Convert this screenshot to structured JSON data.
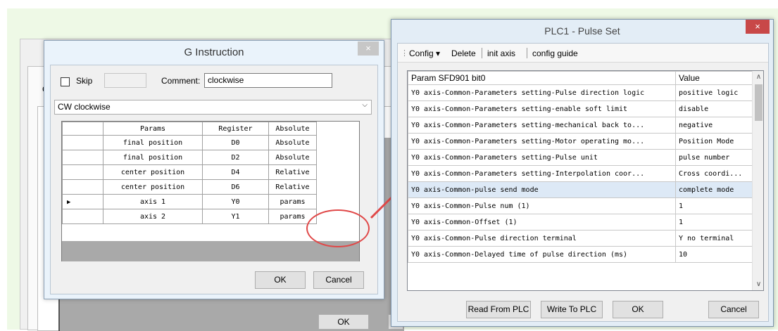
{
  "background_window": {
    "c_label": "C",
    "ok_label": "OK"
  },
  "g_dialog": {
    "title": "G Instruction",
    "close_glyph": "×",
    "skip_label": "Skip",
    "comment_label": "Comment:",
    "comment_value": "clockwise",
    "instruction_value": "CW clockwise",
    "table": {
      "headers": [
        "Params",
        "Register",
        "Absolute"
      ],
      "rows": [
        {
          "param": "final position",
          "register": "D0",
          "absolute": "Absolute"
        },
        {
          "param": "final position",
          "register": "D2",
          "absolute": "Absolute"
        },
        {
          "param": "center position",
          "register": "D4",
          "absolute": "Relative"
        },
        {
          "param": "center position",
          "register": "D6",
          "absolute": "Relative"
        },
        {
          "param": "axis 1",
          "register": "Y0",
          "absolute": "params",
          "current": true
        },
        {
          "param": "axis 2",
          "register": "Y1",
          "absolute": "params"
        }
      ]
    },
    "ok_label": "OK",
    "cancel_label": "Cancel"
  },
  "plc_dialog": {
    "title": "PLC1 - Pulse  Set",
    "close_glyph": "×",
    "toolbar": {
      "config": "Config",
      "config_arrow": "▾",
      "delete": "Delete",
      "init_axis": "init axis",
      "config_guide": "config guide"
    },
    "table": {
      "headers": [
        "Param SFD901 bit0",
        "Value"
      ],
      "rows": [
        {
          "param": "Y0 axis-Common-Parameters setting-Pulse direction logic",
          "value": "positive logic"
        },
        {
          "param": "Y0 axis-Common-Parameters setting-enable soft limit",
          "value": "disable"
        },
        {
          "param": "Y0 axis-Common-Parameters setting-mechanical back to...",
          "value": "negative"
        },
        {
          "param": "Y0 axis-Common-Parameters setting-Motor operating mo...",
          "value": "Position Mode"
        },
        {
          "param": "Y0 axis-Common-Parameters setting-Pulse unit",
          "value": "pulse number"
        },
        {
          "param": "Y0 axis-Common-Parameters setting-Interpolation coor...",
          "value": "Cross coordi..."
        },
        {
          "param": "Y0 axis-Common-pulse send mode",
          "value": "complete mode",
          "selected": true
        },
        {
          "param": "Y0 axis-Common-Pulse num (1)",
          "value": "1"
        },
        {
          "param": "Y0 axis-Common-Offset (1)",
          "value": "1"
        },
        {
          "param": "Y0 axis-Common-Pulse direction terminal",
          "value": "Y no terminal"
        },
        {
          "param": "Y0 axis-Common-Delayed time of pulse direction (ms)",
          "value": "10"
        }
      ]
    },
    "scroll_up": "∧",
    "scroll_down": "∨",
    "read_label": "Read From PLC",
    "write_label": "Write To PLC",
    "ok_label": "OK",
    "cancel_label": "Cancel"
  },
  "colors": {
    "annotation_red": "#e04848",
    "selection": "#dde9f6",
    "green_band": "#eef9e6"
  }
}
